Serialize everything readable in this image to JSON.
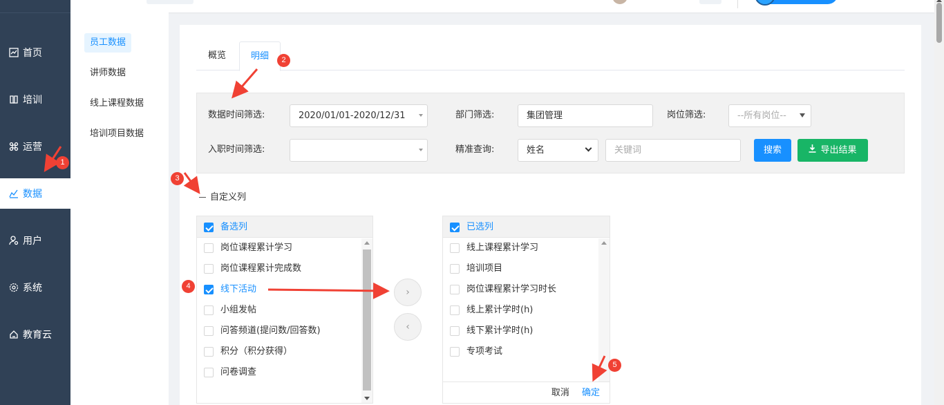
{
  "sidebar": {
    "items": [
      {
        "label": "首页",
        "icon": "chart-line-icon"
      },
      {
        "label": "培训",
        "icon": "book-icon"
      },
      {
        "label": "运营",
        "icon": "command-icon"
      },
      {
        "label": "数据",
        "icon": "bar-chart-icon",
        "active": true
      },
      {
        "label": "用户",
        "icon": "user-settings-icon"
      },
      {
        "label": "系统",
        "icon": "gear-icon"
      },
      {
        "label": "教育云",
        "icon": "cloud-home-icon"
      }
    ]
  },
  "subnav": {
    "items": [
      "员工数据",
      "讲师数据",
      "线上课程数据",
      "培训项目数据"
    ]
  },
  "tabs": {
    "overview": "概览",
    "detail": "明细"
  },
  "filters": {
    "data_time_label": "数据时间筛选:",
    "data_time_value": "2020/01/01-2020/12/31",
    "dept_label": "部门筛选:",
    "dept_value": "集团管理",
    "post_label": "岗位筛选:",
    "post_value": "--所有岗位--",
    "entry_time_label": "入职时间筛选:",
    "entry_time_value": "",
    "exact_label": "精准查询:",
    "exact_field": "姓名",
    "keyword_placeholder": "关键词",
    "search_btn": "搜索",
    "export_btn": "导出结果"
  },
  "custom_columns": {
    "toggle_label": "自定义列",
    "left_title": "备选列",
    "left_items": [
      {
        "label": "岗位课程累计学习",
        "checked": false
      },
      {
        "label": "岗位课程累计完成数",
        "checked": false
      },
      {
        "label": "线下活动",
        "checked": true
      },
      {
        "label": "小组发帖",
        "checked": false
      },
      {
        "label": "问答频道(提问数/回答数)",
        "checked": false
      },
      {
        "label": "积分（积分获得）",
        "checked": false
      },
      {
        "label": "问卷调查",
        "checked": false
      }
    ],
    "right_title": "已选列",
    "right_items": [
      {
        "label": "线上课程累计学习",
        "checked": false
      },
      {
        "label": "培训项目",
        "checked": false
      },
      {
        "label": "岗位课程累计学习时长",
        "checked": false
      },
      {
        "label": "线上累计学时(h)",
        "checked": false
      },
      {
        "label": "线下累计学时(h)",
        "checked": false
      },
      {
        "label": "专项考试",
        "checked": false
      }
    ],
    "cancel": "取消",
    "confirm": "确定",
    "move_right": "›",
    "move_left": "‹"
  },
  "annotations": [
    "1",
    "2",
    "3",
    "4",
    "5"
  ],
  "colors": {
    "sidebar_bg": "#304156",
    "accent": "#1890ff",
    "export_green": "#18b566",
    "marker_red": "#f04134"
  }
}
